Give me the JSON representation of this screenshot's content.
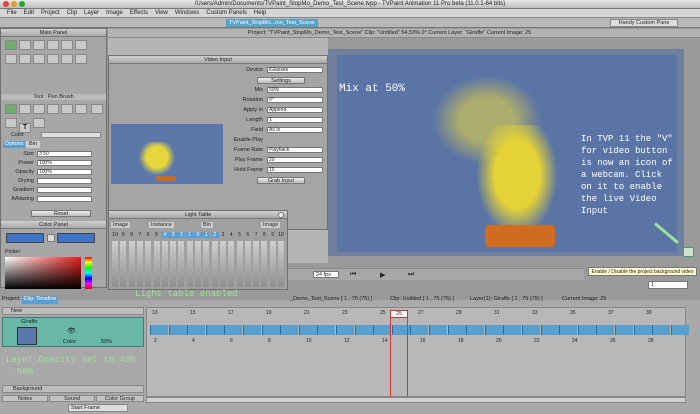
{
  "window": {
    "title": "/Users/Admin/Documents/TVPaint_StopMo_Demo_Test_Scene.tvpp - TVPaint Animation 11 Pro beta (11.0.1-64 bits)"
  },
  "menu": [
    "File",
    "Edit",
    "Project",
    "Clip",
    "Layer",
    "Image",
    "Effects",
    "View",
    "Windows",
    "Custom Panels",
    "Help"
  ],
  "tabs": {
    "project_tab": "TVPaint_StopMo...mo_Test_Scene",
    "custom_pane": "Handy Custom Pane"
  },
  "status_bar": "Project: \"TVPaint_StopMo_Demo_Test_Scene\"  Clip: \"Untitled\"  54.53%  0°  Current Layer: \"Giraffe\"  Current Image: 25",
  "main_panel": {
    "title": "Main Panel",
    "tool_title": "Tool : Pen Brush",
    "color_label": "Color",
    "tabs": [
      "Options",
      "Bin"
    ]
  },
  "brush": {
    "rows": [
      {
        "label": "Size",
        "value": "3.50"
      },
      {
        "label": "Power",
        "value": "100%"
      },
      {
        "label": "Opacity",
        "value": "100%"
      },
      {
        "label": "Drying",
        "value": ""
      },
      {
        "label": "Gradient",
        "value": ""
      },
      {
        "label": "AAliasing",
        "value": ""
      }
    ],
    "reset": "Reset"
  },
  "color_panel": {
    "title": "Color Panel",
    "picker": "Picker"
  },
  "video_input": {
    "title": "Video Input",
    "device_label": "Device",
    "device_value": "iGlasses",
    "settings": "Settings",
    "mix_label": "Mix",
    "mix_value": "50%",
    "rotation_label": "Rotation",
    "rotation_value": "0°",
    "apply_label": "Apply in",
    "apply_value": "Append",
    "length_label": "Length",
    "length_value": "1",
    "field_label": "Field",
    "field_value": "As Is",
    "enable_play": "Enable Play",
    "rate_label": "Frame Rate",
    "rate_value": "Playback",
    "play_label": "Play Frame",
    "play_value": "20",
    "hold_label": "Hold Frame",
    "hold_value": "10",
    "grab": "Grab Input"
  },
  "light_table": {
    "title": "Light Table",
    "cols": [
      "Image",
      "Instance",
      "Bin",
      "Image"
    ],
    "numbers": [
      "10",
      "9",
      "8",
      "7",
      "6",
      "5",
      "4",
      "3",
      "2",
      "1",
      "0",
      "1",
      "2",
      "3",
      "4",
      "5",
      "6",
      "7",
      "8",
      "9",
      "10"
    ]
  },
  "playback": {
    "fps": "24 fps",
    "frame": "1"
  },
  "tooltip": "Enable / Disable the project background video",
  "annotations": {
    "mix": "Mix at 50%",
    "webcam": "In TVP 11 the \"V\" for video button is now an icon of a webcam. Click on it to enable the live Video Input",
    "lighttable": "Light table enabled",
    "opacity": "Layer Opacity set to 40% - 50%"
  },
  "timeline": {
    "tabs": [
      "Project",
      "Clip: Timeline"
    ],
    "info_scene": "_Demo_Test_Scene [ 1 , 75 (75) ]",
    "info_clip": "Clip: Untitled [ 1 , 75 (75) ]",
    "info_layer": "Layer(1): Giraffe [ 1 , 75 (75) ]",
    "info_image": "Current Image: 25",
    "new_label": "New",
    "layer_name": "Giraffe",
    "layer_color": "Color",
    "layer_opacity": "50%",
    "background": "Background",
    "current_frame": "25",
    "ticks_top": [
      "13",
      "15",
      "17",
      "19",
      "21",
      "23",
      "25",
      "27",
      "29",
      "31",
      "33",
      "35",
      "37",
      "39"
    ],
    "ticks_bottom": [
      "2",
      "4",
      "6",
      "8",
      "10",
      "12",
      "14",
      "16",
      "18",
      "20",
      "22",
      "24",
      "26",
      "28"
    ],
    "bottom_buttons": [
      "Notes",
      "Sound",
      "Color Group"
    ],
    "start_frame": "Start Frame"
  }
}
